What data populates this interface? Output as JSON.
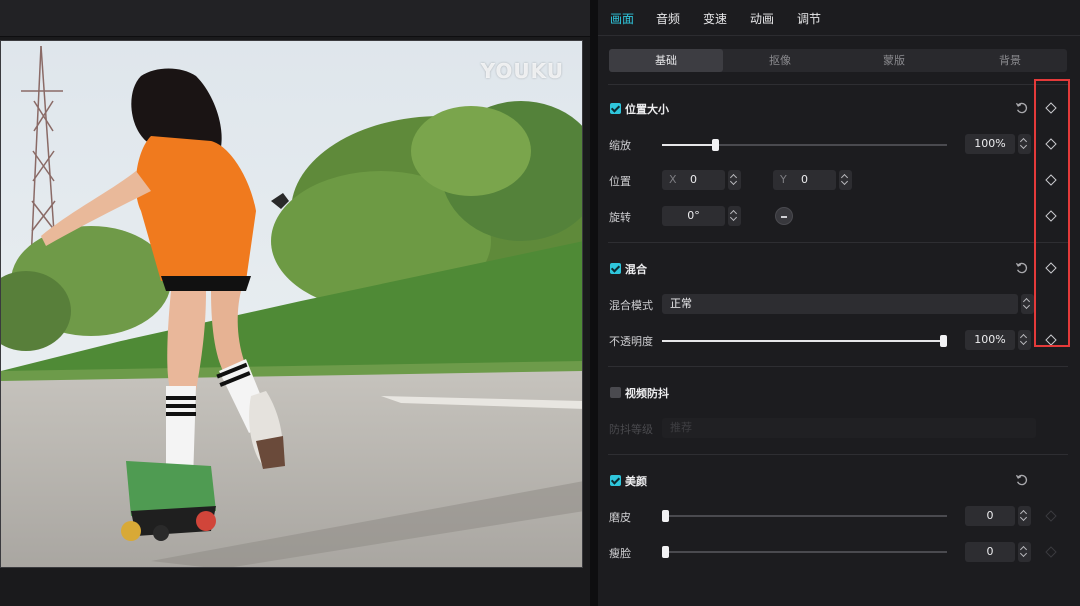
{
  "preview": {
    "watermark": "YOUKU"
  },
  "top_tabs": [
    {
      "label": "画面",
      "active": true
    },
    {
      "label": "音频",
      "active": false
    },
    {
      "label": "变速",
      "active": false
    },
    {
      "label": "动画",
      "active": false
    },
    {
      "label": "调节",
      "active": false
    }
  ],
  "sub_tabs": [
    {
      "label": "基础",
      "active": true
    },
    {
      "label": "抠像",
      "active": false
    },
    {
      "label": "蒙版",
      "active": false
    },
    {
      "label": "背景",
      "active": false
    }
  ],
  "position_size": {
    "title": "位置大小",
    "enabled": true,
    "scale_label": "缩放",
    "scale_value": "100%",
    "scale_fraction": 0.18,
    "position_label": "位置",
    "x_axis": "X",
    "x_value": "0",
    "y_axis": "Y",
    "y_value": "0",
    "rotate_label": "旋转",
    "rotate_value": "0°"
  },
  "blend": {
    "title": "混合",
    "enabled": true,
    "mode_label": "混合模式",
    "mode_value": "正常",
    "opacity_label": "不透明度",
    "opacity_value": "100%",
    "opacity_fraction": 1.0
  },
  "stabilize": {
    "title": "视频防抖",
    "enabled": false,
    "level_label": "防抖等级",
    "level_value": "推荐"
  },
  "beauty": {
    "title": "美颜",
    "enabled": true,
    "smooth_label": "磨皮",
    "smooth_value": "0",
    "smooth_fraction": 0.0,
    "slim_label": "瘦脸",
    "slim_value": "0",
    "slim_fraction": 0.0
  },
  "colors": {
    "accent": "#2fc6dc",
    "highlight": "#e43a3a"
  }
}
